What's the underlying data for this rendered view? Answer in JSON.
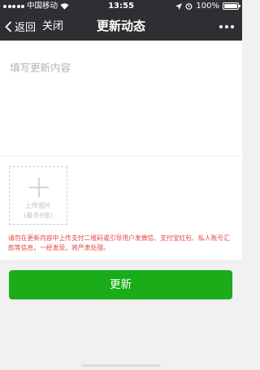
{
  "status_bar": {
    "carrier": "中国移动",
    "time": "13:55",
    "battery": "100%"
  },
  "nav": {
    "back_label": "返回",
    "close_label": "关闭",
    "title": "更新动态"
  },
  "content": {
    "placeholder": "填写更新内容",
    "value": ""
  },
  "upload": {
    "label": "上传图片",
    "sub_label": "(最多9张)"
  },
  "warning": "请勿在更新内容中上传支付二维码或引导用户发微信、支付宝红包、私人账号汇款等信息，一经发现，将严肃处理。",
  "actions": {
    "update_label": "更新"
  },
  "colors": {
    "nav_bg": "#2f2f33",
    "accent_green": "#1aad19",
    "warning_red": "#e64340"
  }
}
